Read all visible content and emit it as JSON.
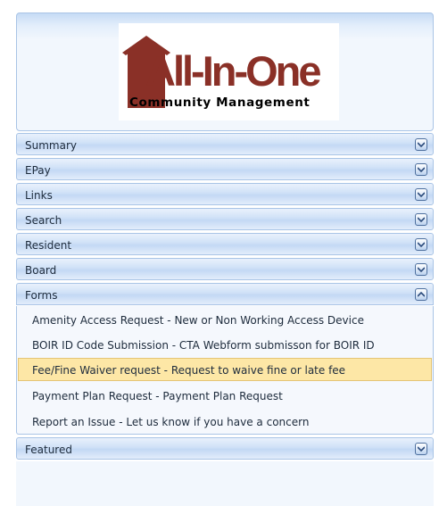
{
  "logo": {
    "title": "All-In-One",
    "subtitle": "Community Management",
    "color": "#8a3027"
  },
  "sections": [
    {
      "label": "Summary",
      "expanded": false
    },
    {
      "label": "EPay",
      "expanded": false
    },
    {
      "label": "Links",
      "expanded": false
    },
    {
      "label": "Search",
      "expanded": false
    },
    {
      "label": "Resident",
      "expanded": false
    },
    {
      "label": "Board",
      "expanded": false
    },
    {
      "label": "Forms",
      "expanded": true
    },
    {
      "label": "Featured",
      "expanded": false
    }
  ],
  "forms_links": [
    "Amenity Access Request - New or Non Working Access Device",
    "BOIR ID Code Submission - CTA Webform submisson for BOIR ID",
    "Fee/Fine Waiver request - Request to waive fine or late fee",
    "Payment Plan Request - Payment Plan Request",
    "Report an Issue - Let us know if you have a concern"
  ],
  "highlight_color": "#fde7a6"
}
